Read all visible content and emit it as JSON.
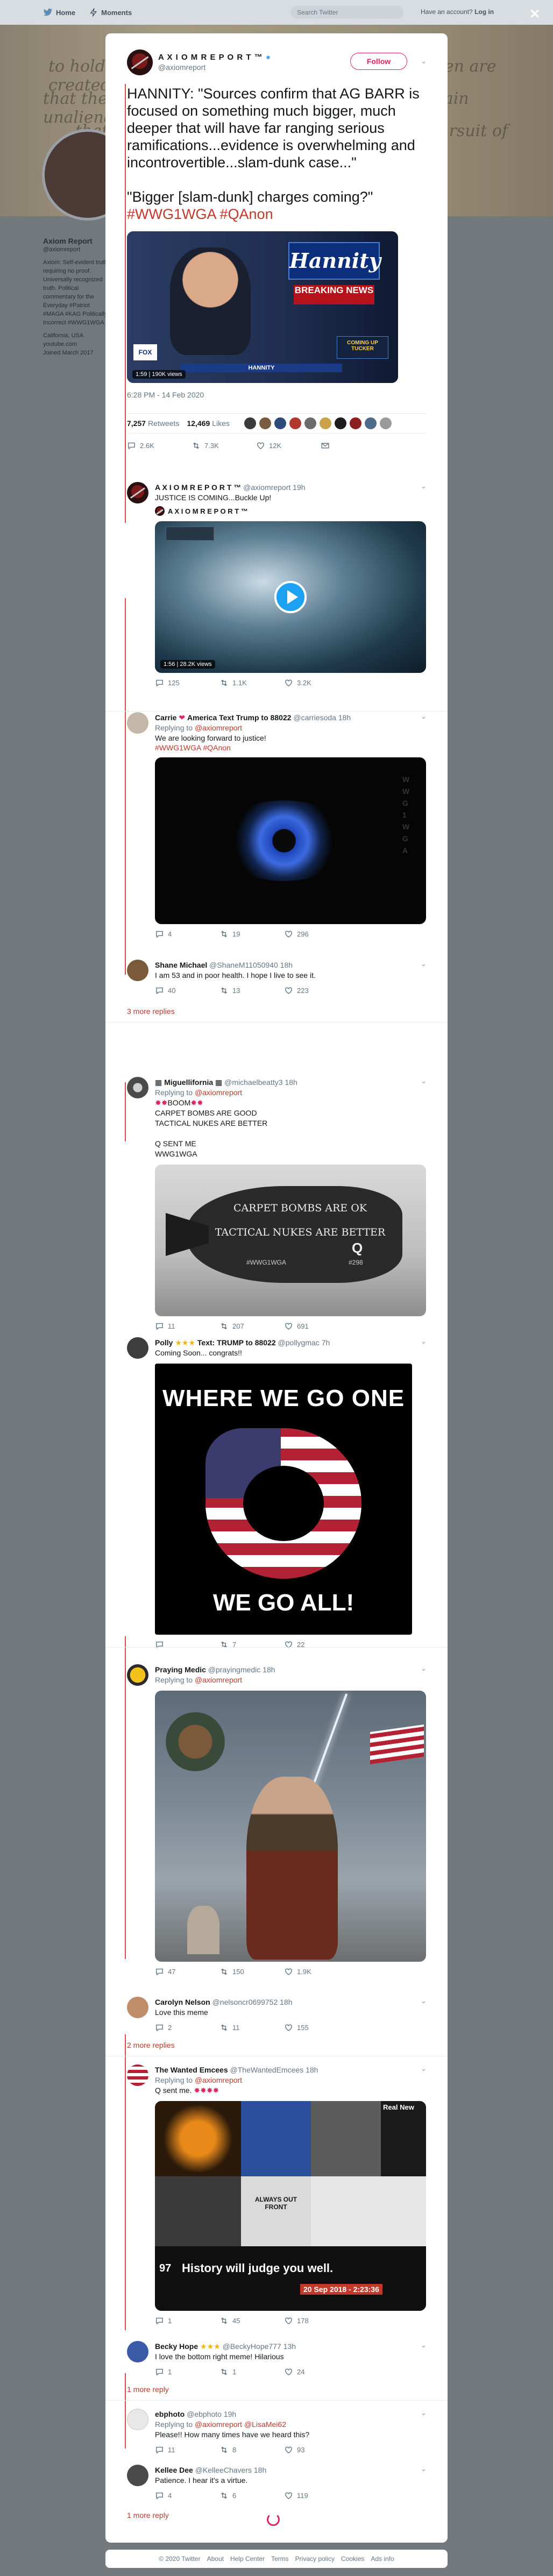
{
  "topbar": {
    "home_label": "Home",
    "moments_label": "Moments",
    "search_placeholder": "Search Twitter",
    "account_prompt": "Have an account?",
    "login_label": "Log in"
  },
  "banner": {
    "script_lines": [
      "to hold these truths to be self-evident, that all men are created equal,",
      "that they are endowed by their Creator with certain unalienable Rights,",
      "that among these are Life, Liberty and the pursuit of Happiness."
    ]
  },
  "background_profile": {
    "name": "Axiom Report",
    "handle": "@axiomreport",
    "bio": "Axiom: Self-evident truth requiring no proof. Universally recognized truth. Political commentary for the Everyday #Patriot #MAGA #KAG Politically Incorrect #WWG1WGA",
    "location": "California, USA",
    "website": "youtube.com",
    "joined": "Joined March 2017"
  },
  "main_tweet": {
    "name": "A X I O M  R E P O R T ™",
    "handle": "@axiomreport",
    "follow_label": "Follow",
    "text_1": "HANNITY: \"Sources confirm that AG BARR is focused on something much bigger, much deeper that will have far ranging serious ramifications...evidence is overwhelming and incontrovertible...slam-dunk case...\"",
    "text_2": "\"Bigger [slam-dunk] charges coming?\"",
    "hashtags": "#WWG1WGA #QAnon",
    "media": {
      "logo": "Hannity",
      "breaking": "BREAKING NEWS",
      "lower_third": "HANNITY",
      "views": "1:59 | 190K views",
      "corner": "COMING UP TUCKER"
    },
    "timestamp": "6:28 PM - 14 Feb 2020",
    "retweets_count": "7,257",
    "retweets_label": "Retweets",
    "likes_count": "12,469",
    "likes_label": "Likes",
    "reply_count": "2.6K",
    "retweet_count": "7.3K",
    "like_count": "12K"
  },
  "self_reply": {
    "name": "A X I O M  R E P O R T ™",
    "handle": "@axiomreport",
    "time": "19h",
    "text": "JUSTICE IS COMING...Buckle Up!",
    "quoted_name": "A X I O M  R E P O R T ™",
    "video_badge": "1:56 | 28.2K views",
    "reply_count": "125",
    "retweet_count": "1.1K",
    "like_count": "3.2K"
  },
  "replies": [
    {
      "name": "Carrie",
      "name_tail": "America Text Trump to 88022",
      "handle": "@carriesoda",
      "time": "18h",
      "replying_to": "@axiomreport",
      "text": "We are looking forward to justice!",
      "hashtags": "#WWG1WGA #QAnon",
      "reply_count": "4",
      "retweet_count": "19",
      "like_count": "296"
    },
    {
      "name": "Shane Michael",
      "handle": "@ShaneM11050940",
      "time": "18h",
      "text": "I am 53 and in poor health. I hope I live to see it.",
      "reply_count": "40",
      "retweet_count": "13",
      "like_count": "223",
      "more_replies": "3 more replies"
    },
    {
      "name": "Miguellifornia",
      "handle": "@michaelbeatty3",
      "time": "18h",
      "replying_to": "@axiomreport",
      "lines": [
        "BOOM",
        "CARPET BOMBS ARE GOOD",
        "TACTICAL NUKES ARE BETTER",
        "",
        "Q SENT ME",
        "WWG1WGA"
      ],
      "media_lines": [
        "CARPET BOMBS ARE OK",
        "TACTICAL NUKES ARE BETTER",
        "#WWG1WGA",
        "#298"
      ],
      "reply_count": "11",
      "retweet_count": "207",
      "like_count": "691"
    },
    {
      "name": "Polly",
      "name_tail": "Text: TRUMP to 88022",
      "handle": "@pollygmac",
      "time": "7h",
      "text": "Coming Soon... congrats!!",
      "media_top": "WHERE WE GO ONE",
      "media_bottom": "WE GO ALL!",
      "reply_count": "",
      "retweet_count": "7",
      "like_count": "22"
    },
    {
      "name": "Praying Medic",
      "handle": "@prayingmedic",
      "time": "18h",
      "replying_to": "@axiomreport",
      "reply_count": "47",
      "retweet_count": "150",
      "like_count": "1.9K"
    },
    {
      "name": "Carolyn Nelson",
      "handle": "@nelsoncr0699752",
      "time": "18h",
      "text": "Love this meme",
      "reply_count": "2",
      "retweet_count": "11",
      "like_count": "155",
      "more_replies": "2 more replies"
    },
    {
      "name": "The Wanted Emcees",
      "handle": "@TheWantedEmcees",
      "time": "18h",
      "replying_to": "@axiomreport",
      "text": "Q sent me.",
      "media_caption": "History will judge you well.",
      "media_front": "ALWAYS OUT FRONT",
      "media_date": "20 Sep 2018 - 2:23:36",
      "media_real": "Real New",
      "media_number": "97",
      "reply_count": "1",
      "retweet_count": "45",
      "like_count": "178"
    },
    {
      "name": "Becky Hope",
      "handle": "@BeckyHope777",
      "time": "13h",
      "text": "I love the bottom right meme! Hilarious",
      "reply_count": "1",
      "retweet_count": "1",
      "like_count": "24",
      "more_replies": "1 more reply"
    },
    {
      "name": "ebphoto",
      "handle": "@ebphoto",
      "time": "19h",
      "replying_to": "@axiomreport @LisaMei62",
      "text": "Please!! How many times have we heard this?",
      "reply_count": "11",
      "retweet_count": "8",
      "like_count": "93"
    },
    {
      "name": "Kellee Dee",
      "handle": "@KelleeChavers",
      "time": "18h",
      "text": "Patience. I hear it's a virtue.",
      "reply_count": "4",
      "retweet_count": "6",
      "like_count": "119",
      "more_replies": "1 more reply"
    }
  ],
  "footer": [
    "© 2020 Twitter",
    "About",
    "Help Center",
    "Terms",
    "Privacy policy",
    "Cookies",
    "Ads info"
  ],
  "colors": {
    "accent": "#e0245e",
    "hashtag": "#c0392b",
    "muted": "#657786",
    "thread_line": "#e2474b"
  }
}
